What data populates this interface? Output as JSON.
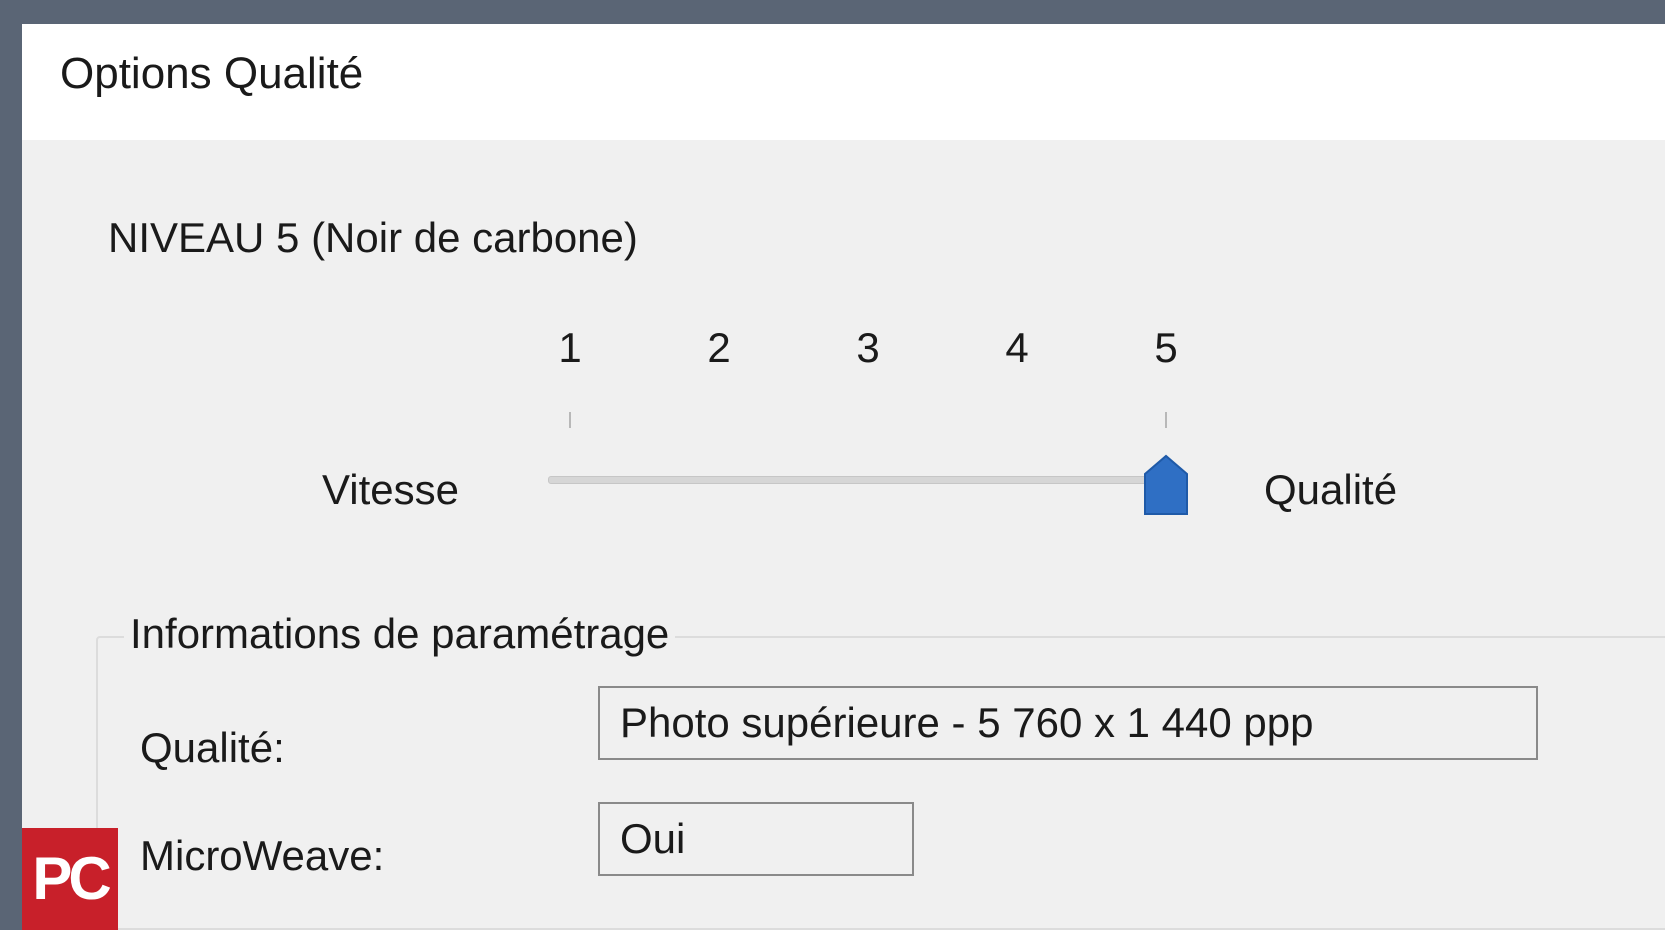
{
  "dialog": {
    "title": "Options Qualité",
    "level_label": "NIVEAU 5 (Noir de carbone)"
  },
  "slider": {
    "ticks": [
      "1",
      "2",
      "3",
      "4",
      "5"
    ],
    "left_label": "Vitesse",
    "right_label": "Qualité",
    "value": 5,
    "min": 1,
    "max": 5,
    "thumb_color": "#2f6fc4"
  },
  "settings_info": {
    "legend": "Informations de paramétrage",
    "fields": [
      {
        "label": "Qualité:",
        "value": "Photo supérieure - 5 760 x 1 440 ppp"
      },
      {
        "label": "MicroWeave:",
        "value": "Oui"
      }
    ]
  },
  "watermark": {
    "text": "PC",
    "color": "#c8202a"
  }
}
